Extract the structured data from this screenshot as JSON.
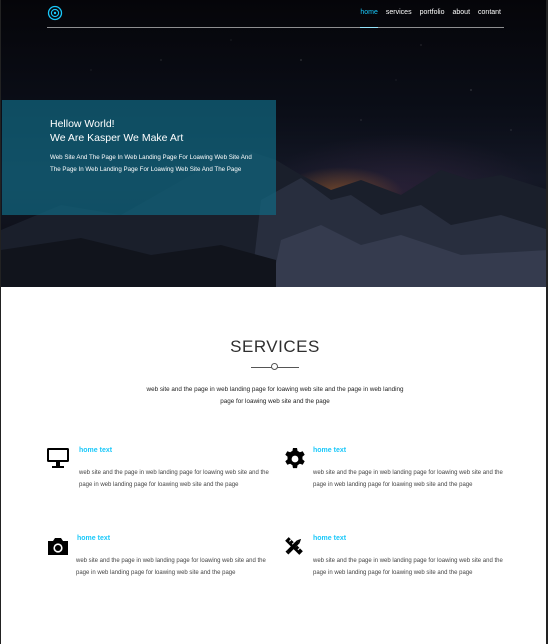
{
  "nav": {
    "items": [
      {
        "label": "home",
        "active": true
      },
      {
        "label": "services",
        "active": false
      },
      {
        "label": "portfolio",
        "active": false
      },
      {
        "label": "about",
        "active": false
      },
      {
        "label": "contant",
        "active": false
      }
    ]
  },
  "hero": {
    "title_line1": "Hellow World!",
    "title_line2": "We Are Kasper We Make Art",
    "description": "Web Site And The Page In Web Landing Page For Loawing Web Site And The Page In Web Landing Page For Loawing Web Site And The Page"
  },
  "services": {
    "title": "SERVICES",
    "intro": "web site and the page in web landing page for loawing web site and the page in web landing page for loawing web site and the page",
    "items": [
      {
        "icon": "monitor-icon",
        "title": "home text",
        "text": "web site and the page in web landing page for loawing web site and the page in web landing page for loawing web site and the page"
      },
      {
        "icon": "gear-icon",
        "title": "home text",
        "text": "web site and the page in web landing page for loawing web site and the page in web landing page for loawing web site and the page"
      },
      {
        "icon": "camera-icon",
        "title": "home text",
        "text": "web site and the page in web landing page for loawing web site and the page in web landing page for loawing web site and the page"
      },
      {
        "icon": "design-tools-icon",
        "title": "home text",
        "text": "web site and the page in web landing page for loawing web site and the page in web landing page for loawing web site and the page"
      }
    ]
  },
  "colors": {
    "accent": "#19c8fa",
    "hero_box": "#116680",
    "text": "#2f2f2f"
  }
}
